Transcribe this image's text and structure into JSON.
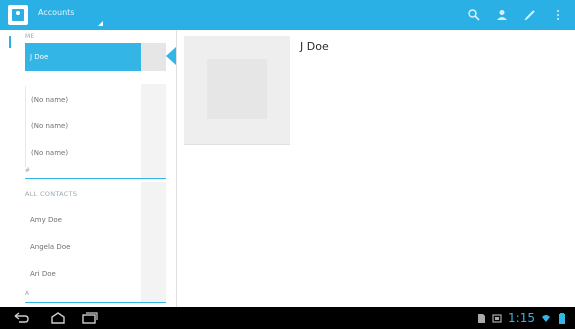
{
  "action_bar": {
    "account_label": "Accounts",
    "icons": [
      "search-icon",
      "add-contact-icon",
      "edit-icon",
      "overflow-menu-icon"
    ]
  },
  "contact_list": {
    "section_header_top": "ME",
    "selected_item": "J Doe",
    "no_name_items": [
      "(No name)",
      "(No name)",
      "(No name)"
    ],
    "index_letter_hash": "#",
    "section_header_all": "ALL CONTACTS",
    "items": [
      "Amy Doe",
      "Angela Doe",
      "Ari Doe"
    ],
    "index_letter_a": "A"
  },
  "detail": {
    "contact_name": "J Doe"
  },
  "system_bar": {
    "time": "1:15",
    "accent_color": "#33b5e5"
  }
}
